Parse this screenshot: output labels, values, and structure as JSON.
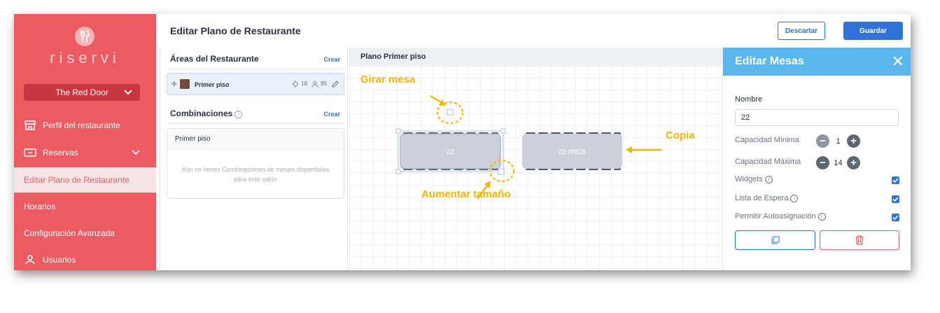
{
  "sidebar": {
    "brand": "riservi",
    "restaurant_select": "The Red Door",
    "items": [
      {
        "label": "Perfil del restaurante"
      },
      {
        "label": "Reservas"
      },
      {
        "label": "Editar Plano de Restaurante"
      },
      {
        "label": "Horarios"
      },
      {
        "label": "Configuración Avanzada"
      },
      {
        "label": "Usuarios"
      }
    ]
  },
  "header": {
    "title": "Editar Plano de Restaurante",
    "discard_label": "Descartar",
    "save_label": "Guardar"
  },
  "areas": {
    "title": "Áreas del Restaurante",
    "create_label": "Crear",
    "item": {
      "name": "Primer piso",
      "tables": "18",
      "capacity": "85"
    },
    "combinations_title": "Combinaciones",
    "combinations_create_label": "Crear",
    "combination_box_title": "Primer piso",
    "combination_empty": "Aún no tienes Combinaciones de mesas disponibiles para este salón"
  },
  "canvas": {
    "title": "Plano Primer piso",
    "tables": [
      {
        "label": "22"
      },
      {
        "label": "22-/#928"
      }
    ],
    "annotations": {
      "rotate": "Girar mesa",
      "copy": "Copia",
      "resize": "Aumentar tamaño"
    }
  },
  "edit_panel": {
    "title": "Editar Mesas",
    "name_label": "Nombre",
    "name_value": "22",
    "min_capacity_label": "Capacidad Mínima",
    "min_capacity_value": "1",
    "max_capacity_label": "Capacidad Máxima",
    "max_capacity_value": "14",
    "widgets_label": "Widgets",
    "waitlist_label": "Lista de Espera",
    "autoassign_label": "Permitir Autoasignación",
    "widgets_checked": true,
    "waitlist_checked": true,
    "autoassign_checked": true
  },
  "colors": {
    "brand": "#ec5a62",
    "accent": "#2f74d8",
    "panel_header": "#5ab7ee",
    "annotation": "#f5b400"
  }
}
